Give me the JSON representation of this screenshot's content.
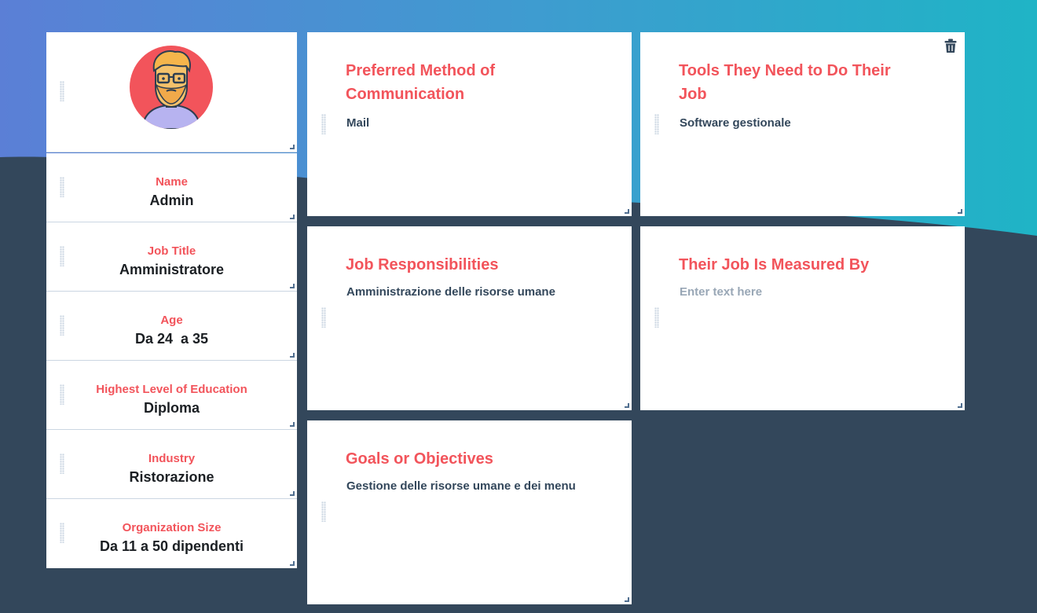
{
  "profile_fields": [
    {
      "label": "Name",
      "value": "Admin"
    },
    {
      "label": "Job Title",
      "value": "Amministratore"
    },
    {
      "label": "Age",
      "value": "Da 24  a 35"
    },
    {
      "label": "Highest Level of Education",
      "value": "Diploma"
    },
    {
      "label": "Industry",
      "value": "Ristorazione"
    },
    {
      "label": "Organization Size",
      "value": "Da 11 a 50 dipendenti"
    }
  ],
  "cards": {
    "communication": {
      "title": "Preferred Method of Communication",
      "body": "Mail"
    },
    "tools": {
      "title": "Tools They Need to Do Their Job",
      "body": "Software gestionale"
    },
    "responsibilities": {
      "title": "Job Responsibilities",
      "body": "Amministrazione delle risorse umane"
    },
    "measured": {
      "title": "Their Job Is Measured By",
      "placeholder": "Enter text here"
    },
    "goals": {
      "title": "Goals or Objectives",
      "body": "Gestione delle risorse umane e dei menu"
    }
  },
  "icons": {
    "avatar": "bearded-man-avatar",
    "delete": "trash-icon",
    "drag": "drag-handle-icon",
    "resize": "resize-handle-icon"
  },
  "colors": {
    "accent": "#f2545b",
    "text_dark": "#33475b",
    "background_dark": "#33475b",
    "gradient_start": "#5b7fd6",
    "gradient_end": "#1fb4c6"
  }
}
